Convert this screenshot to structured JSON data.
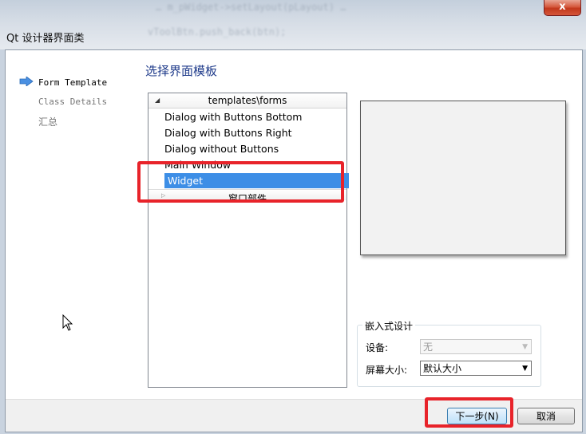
{
  "window": {
    "title": "Qt 设计器界面类",
    "close_label": "x",
    "background_code_lines": [
      "… m_pWidget->setLayout(pLayout) …",
      "vToolBtn.push_back(btn);"
    ]
  },
  "steps": [
    {
      "label": "Form Template",
      "active": true
    },
    {
      "label": "Class Details",
      "active": false
    },
    {
      "label": "汇总",
      "active": false
    }
  ],
  "section_title": "选择界面模板",
  "tree": {
    "header": "templates\\forms",
    "items": [
      "Dialog with Buttons Bottom",
      "Dialog with Buttons Right",
      "Dialog without Buttons",
      "Main Window",
      "Widget"
    ],
    "selected": "Widget",
    "subgroup": "窗口部件"
  },
  "embedded": {
    "group_title": "嵌入式设计",
    "device_label": "设备:",
    "device_value": "无",
    "screen_label": "屏幕大小:",
    "screen_value": "默认大小"
  },
  "buttons": {
    "next": "下一步(N)",
    "cancel": "取消"
  },
  "colors": {
    "accent_title": "#1e3a8a",
    "selection": "#3d8ee6",
    "annotation": "#e8232a"
  }
}
